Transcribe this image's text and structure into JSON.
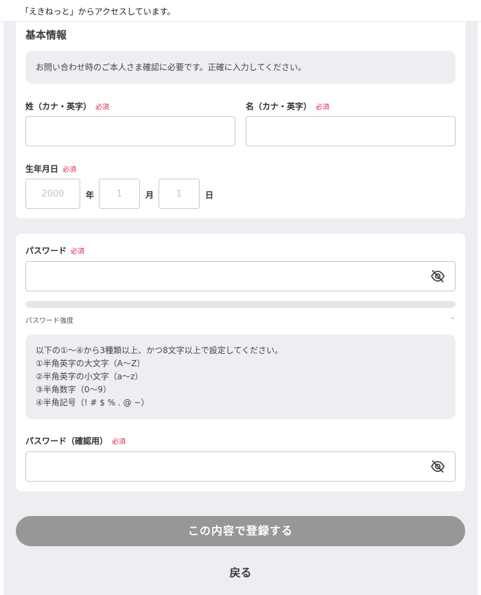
{
  "banner": {
    "text": "「えきねっと」からアクセスしています。"
  },
  "basic_info": {
    "title": "基本情報",
    "note": "お問い合わせ時のご本人さま確認に必要です。正確に入力してください。",
    "last_name_label": "姓（カナ・英字）",
    "first_name_label": "名（カナ・英字）",
    "required": "必須",
    "birthdate_label": "生年月日",
    "year_placeholder": "2000",
    "year_unit": "年",
    "month_placeholder": "1",
    "month_unit": "月",
    "day_placeholder": "1",
    "day_unit": "日"
  },
  "password": {
    "label": "パスワード",
    "required": "必須",
    "strength_label": "パスワード強度",
    "strength_value": "-",
    "strength_level": 0,
    "rules_intro": "以下の①〜④から3種類以上、かつ8文字以上で設定してください。",
    "rules": [
      "①半角英字の大文字（A〜Z）",
      "②半角英字の小文字（a〜z）",
      "③半角数字（0〜9）",
      "④半角記号（! # $ % . @ ~）"
    ],
    "confirm_label": "パスワード（確認用）",
    "confirm_required": "必須",
    "eye_icon": "eye-slash-icon"
  },
  "actions": {
    "submit_label": "この内容で登録する",
    "back_label": "戻る"
  },
  "colors": {
    "page_bg": "#eeedf2",
    "required": "#d62a4c",
    "submit_disabled": "#979797"
  }
}
